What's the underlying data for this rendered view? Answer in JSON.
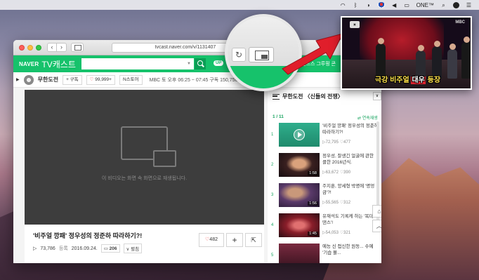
{
  "menubar": {
    "clock": "ONE™"
  },
  "browser": {
    "url": "tvcast.naver.com/v/1131407"
  },
  "naver": {
    "logo_naver": "NAVER",
    "logo_cast": "TV캐스트",
    "up_badge": "UP",
    "ticker": "리스, '랜드스 그루핑 콘"
  },
  "channel": {
    "name": "무한도전",
    "subscribe": "+ 구독",
    "likes": "99,999+",
    "nstore": "N스토어",
    "info": "MBC    토 오후 06:25 ~ 07:45    구독 150,750명"
  },
  "player": {
    "message": "이 비디오는 화면 속 화면으로 재생됩니다."
  },
  "video": {
    "title": "'비주얼 깡패' 정우성의 정준하 따라하기?!",
    "views": "73,786",
    "date_label": "등록",
    "date": "2016.09.24.",
    "comments": "206",
    "expand": "펼침",
    "likes": "482"
  },
  "playlist": {
    "title": "무한도전 〈신들의 전쟁〉",
    "count": "1 / 11",
    "autoplay": "연속재생",
    "items": [
      {
        "num": "1",
        "title": "'비주얼 깡패' 정우성의 정준하 따라하기?!",
        "views": "72,795",
        "likes": "477",
        "duration": ""
      },
      {
        "num": "2",
        "title": "정우성, 잘생긴 얼굴에 관한 클한 2016년식.",
        "views": "63,672",
        "likes": "390",
        "duration": "1:58"
      },
      {
        "num": "3",
        "title": "주지훈, 양세형 박명에 '명엉금'?!",
        "views": "55,565",
        "likes": "312",
        "duration": "1:56"
      },
      {
        "num": "4",
        "title": "유재석도 기록케 하는 '복대 댄스'!",
        "views": "54,053",
        "likes": "321",
        "duration": "1:45"
      },
      {
        "num": "5",
        "title": "예능 신 접신한 원동... 수예 '기습 볼...",
        "views": "",
        "likes": "",
        "duration": ""
      }
    ]
  },
  "pip": {
    "channel": "MBC",
    "caption_pre": "극강 비주얼",
    "caption_hl": "대우",
    "caption_post": "등장"
  }
}
